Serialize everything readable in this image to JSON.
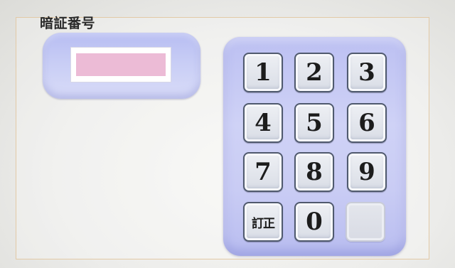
{
  "title": "暗証番号",
  "pin": {
    "value": "",
    "field_color": "#ecbbd6"
  },
  "keypad": {
    "keys": [
      {
        "label": "1",
        "name": "key-1"
      },
      {
        "label": "2",
        "name": "key-2"
      },
      {
        "label": "3",
        "name": "key-3"
      },
      {
        "label": "4",
        "name": "key-4"
      },
      {
        "label": "5",
        "name": "key-5"
      },
      {
        "label": "6",
        "name": "key-6"
      },
      {
        "label": "7",
        "name": "key-7"
      },
      {
        "label": "8",
        "name": "key-8"
      },
      {
        "label": "9",
        "name": "key-9"
      },
      {
        "label": "訂正",
        "name": "correct-button"
      },
      {
        "label": "0",
        "name": "key-0"
      },
      {
        "label": "",
        "name": "blank-key"
      }
    ]
  },
  "colors": {
    "panel_accent": "#c3c7f4",
    "frame_border": "#e2c9a6"
  }
}
